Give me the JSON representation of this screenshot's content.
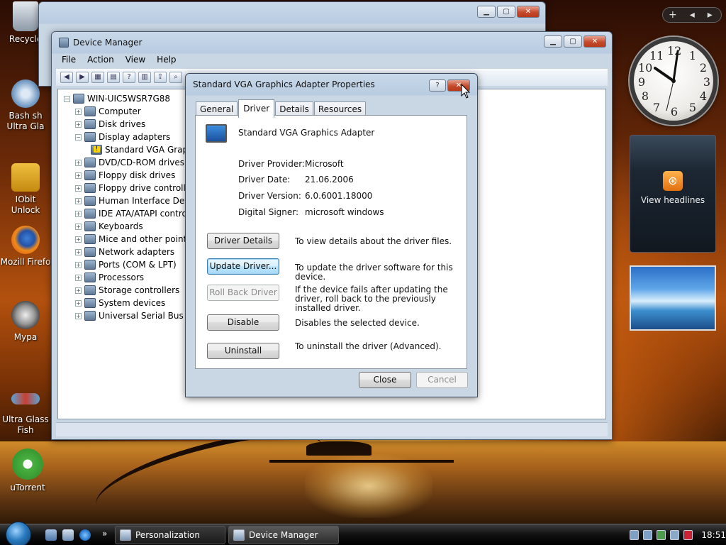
{
  "desktop_icons": [
    {
      "label": "Recycle",
      "icon": "recycle-bin-icon"
    },
    {
      "label": "Bash sh Ultra Gla",
      "icon": "gear-shortcut-icon"
    },
    {
      "label": "IObit Unlock",
      "icon": "unlocker-icon"
    },
    {
      "label": "Mozill Firefo",
      "icon": "firefox-icon"
    },
    {
      "label": "Mypa",
      "icon": "raccoon-icon"
    },
    {
      "label": "Ultra Glass Fish",
      "icon": "fish-icon"
    },
    {
      "label": "uTorrent",
      "icon": "utorrent-icon"
    }
  ],
  "device_manager": {
    "title": "Device Manager",
    "menu": [
      "File",
      "Action",
      "View",
      "Help"
    ],
    "root": "WIN-UIC5WSR7G88",
    "tree": [
      {
        "label": "Computer",
        "expanded": false,
        "level": 1
      },
      {
        "label": "Disk drives",
        "expanded": false,
        "level": 1
      },
      {
        "label": "Display adapters",
        "expanded": true,
        "level": 1
      },
      {
        "label": "Standard VGA Grap",
        "expanded": null,
        "level": 2,
        "warning": true
      },
      {
        "label": "DVD/CD-ROM drives",
        "expanded": false,
        "level": 1
      },
      {
        "label": "Floppy disk drives",
        "expanded": false,
        "level": 1
      },
      {
        "label": "Floppy drive controller",
        "expanded": false,
        "level": 1
      },
      {
        "label": "Human Interface Devic",
        "expanded": false,
        "level": 1
      },
      {
        "label": "IDE ATA/ATAPI contro",
        "expanded": false,
        "level": 1
      },
      {
        "label": "Keyboards",
        "expanded": false,
        "level": 1
      },
      {
        "label": "Mice and other pointin",
        "expanded": false,
        "level": 1
      },
      {
        "label": "Network adapters",
        "expanded": false,
        "level": 1
      },
      {
        "label": "Ports (COM & LPT)",
        "expanded": false,
        "level": 1
      },
      {
        "label": "Processors",
        "expanded": false,
        "level": 1
      },
      {
        "label": "Storage controllers",
        "expanded": false,
        "level": 1
      },
      {
        "label": "System devices",
        "expanded": false,
        "level": 1
      },
      {
        "label": "Universal Serial Bus co",
        "expanded": false,
        "level": 1
      }
    ]
  },
  "back_window": {
    "title": "Personalization"
  },
  "dialog": {
    "title": "Standard VGA Graphics Adapter Properties",
    "help_label": "?",
    "close_glyph": "✕",
    "tabs": [
      "General",
      "Driver",
      "Details",
      "Resources"
    ],
    "active_tab": "Driver",
    "device_name": "Standard VGA Graphics Adapter",
    "fields": [
      {
        "key": "Driver Provider:",
        "value": "Microsoft"
      },
      {
        "key": "Driver Date:",
        "value": "21.06.2006"
      },
      {
        "key": "Driver Version:",
        "value": "6.0.6001.18000"
      },
      {
        "key": "Digital Signer:",
        "value": "microsoft windows"
      }
    ],
    "actions": [
      {
        "button": "Driver Details",
        "desc": "To view details about the driver files.",
        "state": "normal"
      },
      {
        "button": "Update Driver...",
        "desc": "To update the driver software for this device.",
        "state": "focus"
      },
      {
        "button": "Roll Back Driver",
        "desc": "If the device fails after updating the driver, roll back to the previously installed driver.",
        "state": "disabled"
      },
      {
        "button": "Disable",
        "desc": "Disables the selected device.",
        "state": "normal"
      },
      {
        "button": "Uninstall",
        "desc": "To uninstall the driver (Advanced).",
        "state": "normal"
      }
    ],
    "close_button": "Close",
    "cancel_button": "Cancel"
  },
  "gadgets": {
    "sidebar_controls": [
      "+",
      "◂",
      "▸"
    ],
    "clock_numbers": [
      "12",
      "1",
      "2",
      "3",
      "4",
      "5",
      "6",
      "7",
      "8",
      "9",
      "10",
      "11"
    ],
    "rss_label": "View headlines",
    "rss_glyph": "⊛"
  },
  "taskbar": {
    "tasks": [
      {
        "label": "Personalization",
        "active": false
      },
      {
        "label": "Device Manager",
        "active": true
      }
    ],
    "overflow": "»",
    "time": "18:51"
  }
}
